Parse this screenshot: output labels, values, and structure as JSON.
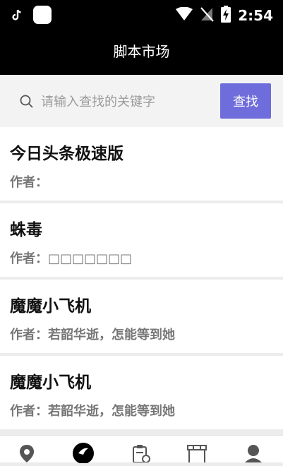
{
  "status_bar": {
    "time": "2:54",
    "icons": [
      "tiktok-icon",
      "app-icon",
      "wifi-icon",
      "no-sim-icon",
      "battery-charging-icon"
    ]
  },
  "header": {
    "title": "脚本市场"
  },
  "search": {
    "placeholder": "请输入查找的关键字",
    "value": "",
    "button_label": "查找"
  },
  "scripts": [
    {
      "title": "今日头条极速版",
      "author": "作者："
    },
    {
      "title": "蛛毒",
      "author": "作者：□□□□□□□"
    },
    {
      "title": "魔魔小飞机",
      "author": "作者：若韶华逝，怎能等到她"
    },
    {
      "title": "魔魔小飞机",
      "author": "作者：若韶华逝，怎能等到她"
    }
  ],
  "bottom_nav": {
    "items": [
      "location-icon",
      "explore-icon",
      "script-icon",
      "store-icon",
      "profile-icon"
    ],
    "active_index": 1
  }
}
